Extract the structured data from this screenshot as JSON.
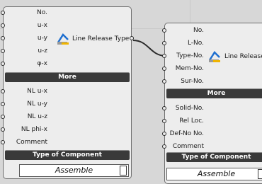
{
  "component_left": {
    "inputs": [
      "No.",
      "u-x",
      "u-y",
      "u-z",
      "φ-x"
    ],
    "more_label": "More",
    "extra_inputs": [
      "NL u-x",
      "NL u-y",
      "NL u-z",
      "NL phi-x",
      "Comment"
    ],
    "type_label": "Type of Component",
    "type_value": "Assemble",
    "output_label": "Line Release Type"
  },
  "component_right": {
    "inputs": [
      "No.",
      "L-No.",
      "Type-No.",
      "Mem-No.",
      "Sur-No."
    ],
    "more_label": "More",
    "extra_inputs": [
      "Solid-No.",
      "Rel Loc.",
      "Def-No No.",
      "Comment"
    ],
    "type_label": "Type of Component",
    "type_value": "Assemble",
    "output_label": "Line Release"
  },
  "colors": {
    "canvas": "#d7d7d7",
    "component_body": "#ededed",
    "section_bar": "#3a3a3a",
    "wire": "#2b2b2b"
  },
  "icon": "line-release-icon"
}
